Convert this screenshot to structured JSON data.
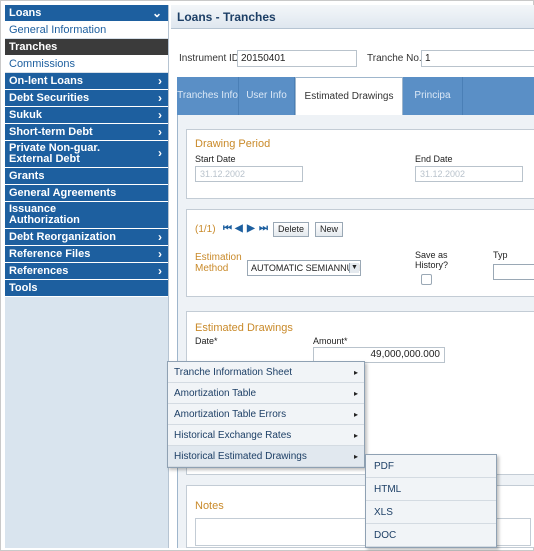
{
  "sidebar": {
    "items": [
      {
        "label": "Loans",
        "style": "blue",
        "arrow": "⌄"
      },
      {
        "label": "General Information",
        "style": "white"
      },
      {
        "label": "Tranches",
        "style": "sel"
      },
      {
        "label": "Commissions",
        "style": "white"
      },
      {
        "label": "On-lent Loans",
        "style": "blue",
        "arrow": "›"
      },
      {
        "label": "Debt Securities",
        "style": "blue",
        "arrow": "›"
      },
      {
        "label": "Sukuk",
        "style": "blue",
        "arrow": "›"
      },
      {
        "label": "Short-term Debt",
        "style": "blue",
        "arrow": "›"
      },
      {
        "label": "Private Non-guar. External Debt",
        "style": "blue tall",
        "arrow": "›"
      },
      {
        "label": "Grants",
        "style": "blue"
      },
      {
        "label": "General Agreements",
        "style": "blue"
      },
      {
        "label": "Issuance Authorization",
        "style": "blue tall"
      },
      {
        "label": "Debt Reorganization",
        "style": "blue",
        "arrow": "›"
      },
      {
        "label": "Reference Files",
        "style": "blue",
        "arrow": "›"
      },
      {
        "label": "References",
        "style": "blue",
        "arrow": "›"
      },
      {
        "label": "Tools",
        "style": "blue"
      }
    ]
  },
  "main": {
    "title": "Loans - Tranches",
    "instrument_label": "Instrument ID",
    "instrument_value": "20150401",
    "tranche_label": "Tranche No.",
    "tranche_value": "1"
  },
  "tabs": [
    "Tranches Info",
    "User Info",
    "Estimated Drawings",
    "Principa"
  ],
  "drawing_period": {
    "title": "Drawing Period",
    "start_label": "Start Date",
    "start_value": "31.12.2002",
    "end_label": "End Date",
    "end_value": "31.12.2002"
  },
  "estimation": {
    "pager": "(1/1)",
    "delete_label": "Delete",
    "new_label": "New",
    "method_label": "Estimation Method",
    "method_value": "AUTOMATIC SEMIANNUAL",
    "save_history_label": "Save as History?",
    "type_label": "Typ"
  },
  "estimated_drawings": {
    "title": "Estimated Drawings",
    "date_label": "Date*",
    "amount_label": "Amount*",
    "amount_value": "49,000,000.000"
  },
  "notes": {
    "title": "Notes"
  },
  "tools_menu": {
    "items": [
      {
        "label": "Tranche Information Sheet",
        "sub": "▸"
      },
      {
        "label": "Amortization Table",
        "sub": "▸"
      },
      {
        "label": "Amortization Table Errors",
        "sub": "▸"
      },
      {
        "label": "Historical Exchange Rates",
        "sub": "▸"
      },
      {
        "label": "Historical Estimated Drawings",
        "sub": "▸"
      }
    ]
  },
  "export_menu": {
    "items": [
      "PDF",
      "HTML",
      "XLS",
      "DOC"
    ]
  },
  "colors": {
    "accent": "#1d5f9f",
    "selected": "#3b3b3b",
    "tab_bar": "#5a8fc6",
    "section_title": "#c98a2a"
  }
}
